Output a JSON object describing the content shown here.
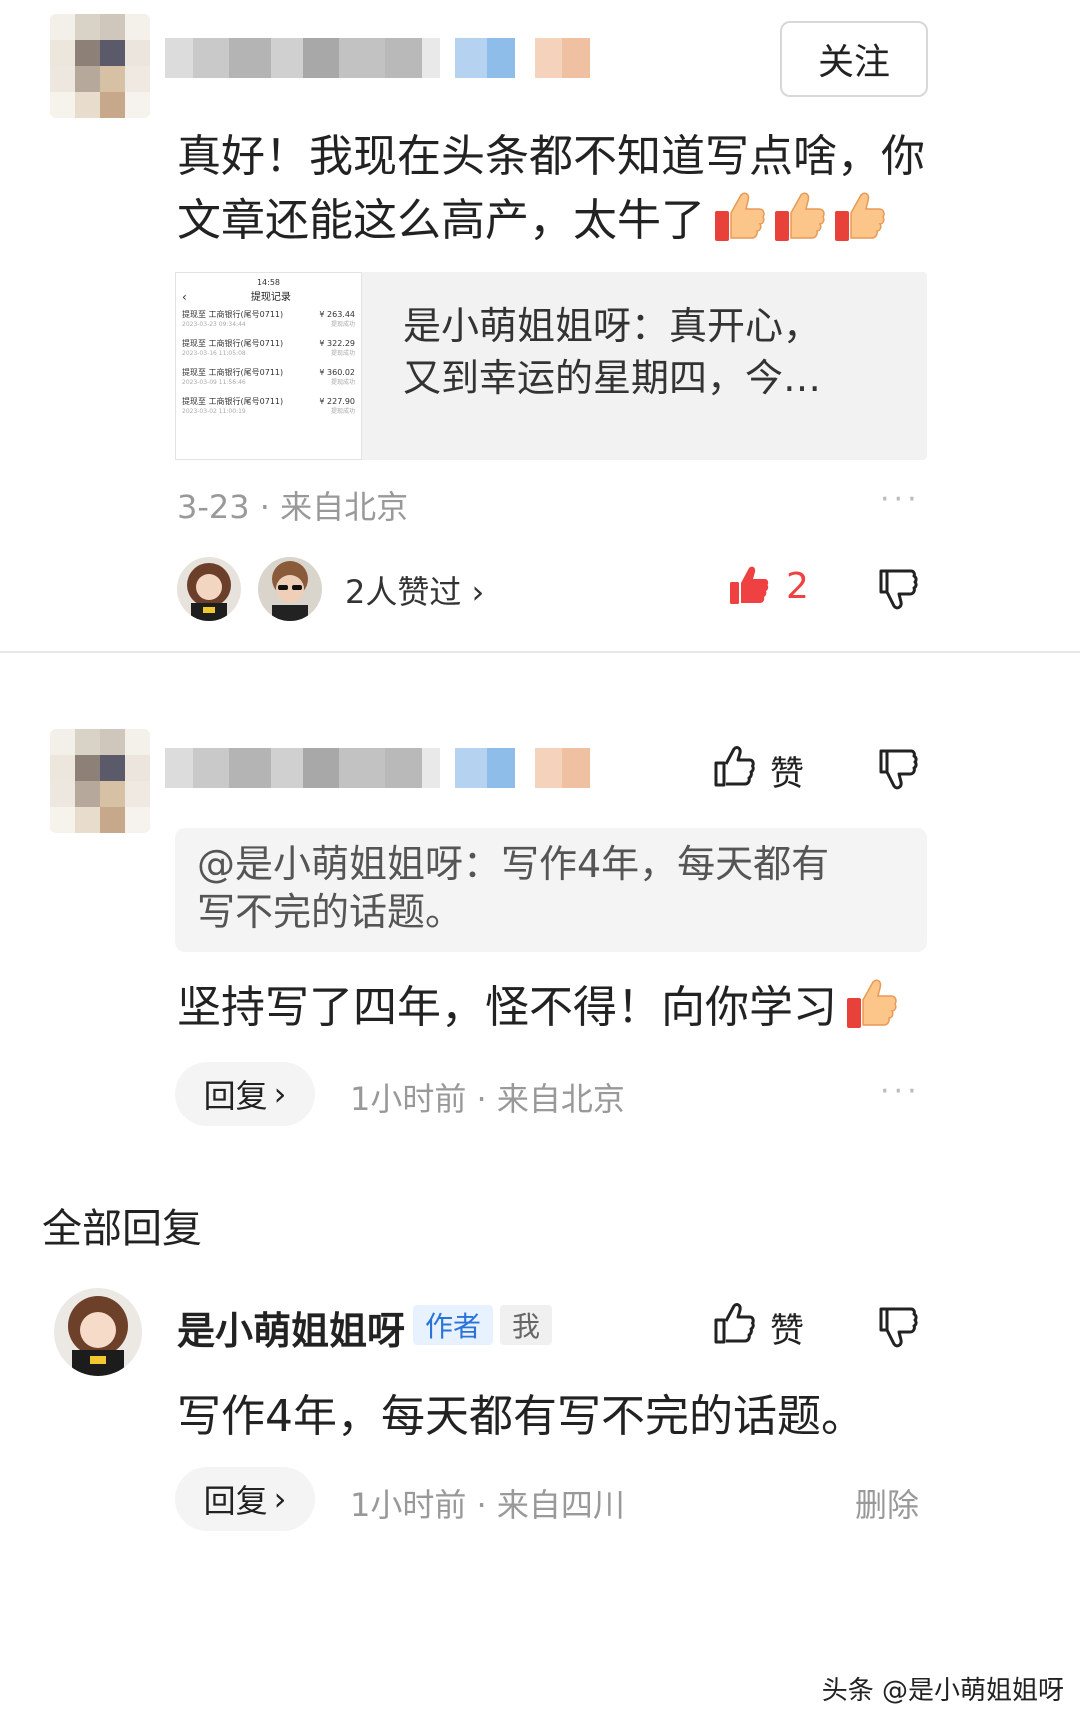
{
  "comment1": {
    "follow_label": "关注",
    "text_line1": "真好！我现在头条都不知道写点啥，你",
    "text_line2": "文章还能这么高产，太牛了",
    "quote_card": {
      "thumb_title": "提现记录",
      "thumb_status": "14:58",
      "thumb_rows": [
        {
          "label": "提现至 工商银行(尾号0711)",
          "amount": "¥ 263.44",
          "date": "2023-03-23 09:34:44",
          "state": "提现成功"
        },
        {
          "label": "提现至 工商银行(尾号0711)",
          "amount": "¥ 322.29",
          "date": "2023-03-16 11:05:08",
          "state": "提现成功"
        },
        {
          "label": "提现至 工商银行(尾号0711)",
          "amount": "¥ 360.02",
          "date": "2023-03-09 11:56:46",
          "state": "提现成功"
        },
        {
          "label": "提现至 工商银行(尾号0711)",
          "amount": "¥ 227.90",
          "date": "2023-03-02 11:00:19",
          "state": "提现成功"
        }
      ],
      "text_line1": "是小萌姐姐呀：真开心，",
      "text_line2": "又到幸运的星期四，今…"
    },
    "meta": "3-23 · 来自北京",
    "more": "···",
    "likers_label": "2人赞过 ›",
    "like_count": "2"
  },
  "comment2": {
    "like_label": "赞",
    "quote_line1": "@是小萌姐姐呀：写作4年，每天都有",
    "quote_line2": "写不完的话题。",
    "text": "坚持写了四年，怪不得！向你学习",
    "reply_label": "回复",
    "meta": "1小时前 · 来自北京",
    "more": "···"
  },
  "all_replies_title": "全部回复",
  "reply": {
    "author": "是小萌姐姐呀",
    "badge_author": "作者",
    "badge_me": "我",
    "like_label": "赞",
    "text": "写作4年，每天都有写不完的话题。",
    "reply_label": "回复",
    "meta": "1小时前 · 来自四川",
    "delete_label": "删除"
  },
  "watermark": "头条 @是小萌姐姐呀",
  "colors": {
    "like_red": "#f04142",
    "badge_blue": "#2a73d9",
    "meta_gray": "#999999"
  }
}
